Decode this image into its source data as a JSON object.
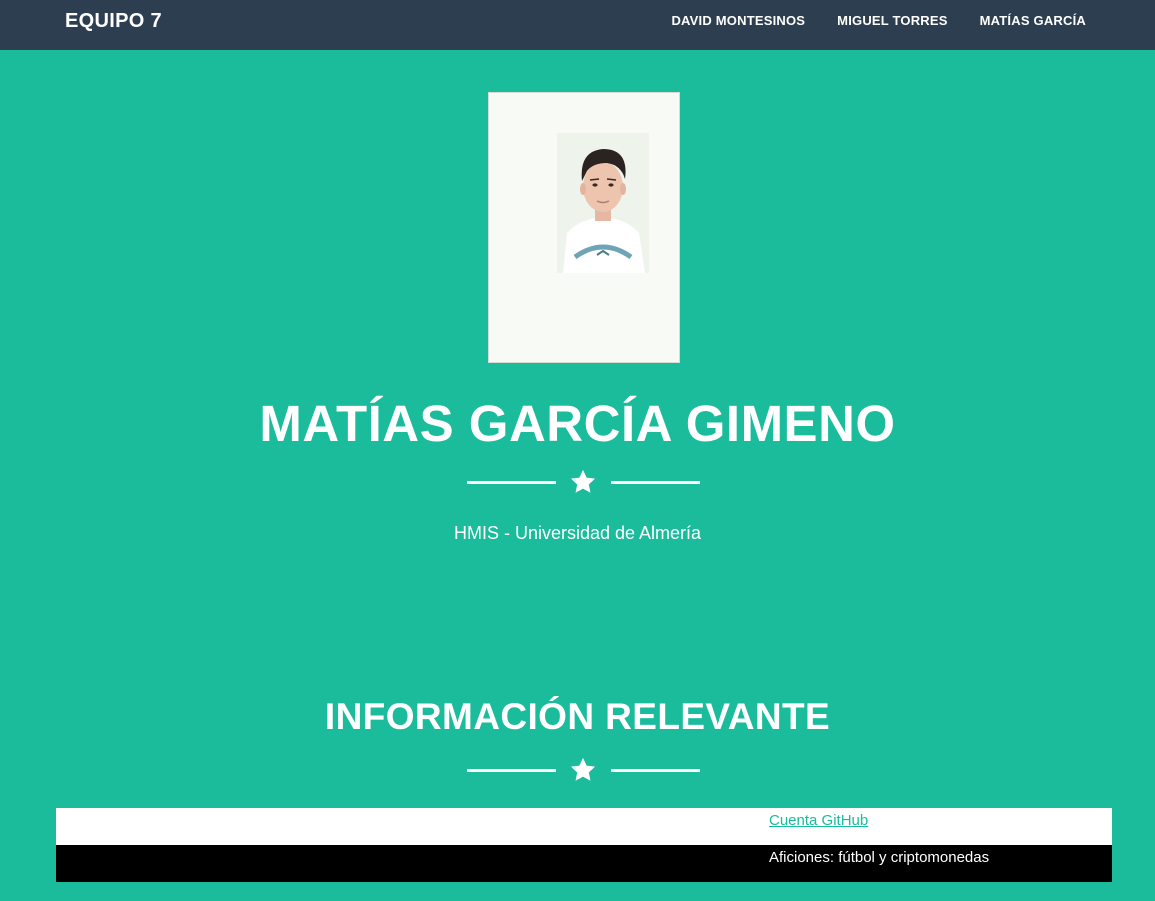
{
  "navbar": {
    "brand": "EQUIPO 7",
    "links": [
      "DAVID MONTESINOS",
      "MIGUEL TORRES",
      "MATÍAS GARCÍA"
    ]
  },
  "hero": {
    "name": "MATÍAS GARCÍA GIMENO",
    "divider_icon": "star-icon",
    "subtitle": "HMIS - Universidad de Almería"
  },
  "info": {
    "title": "INFORMACIÓN RELEVANTE",
    "divider_icon": "star-icon",
    "rows": [
      {
        "text": "Cuenta GitHub"
      },
      {
        "text": "Aficiones: fútbol y criptomonedas"
      }
    ]
  },
  "colors": {
    "background": "#1abc9c",
    "navbar": "#2c3e50",
    "text": "#ffffff",
    "link": "#1abc9c"
  }
}
